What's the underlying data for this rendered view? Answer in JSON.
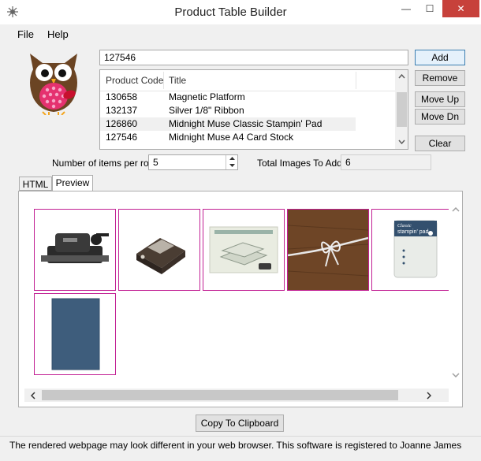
{
  "window": {
    "title": "Product Table Builder",
    "minimize": "—",
    "maximize": "☐",
    "close": "✕"
  },
  "menu": {
    "file": "File",
    "help": "Help"
  },
  "product_input": {
    "value": "127546"
  },
  "buttons": {
    "add": "Add",
    "remove": "Remove",
    "move_up": "Move Up",
    "move_down": "Move Dn",
    "clear": "Clear",
    "copy": "Copy To Clipboard"
  },
  "list": {
    "columns": [
      "Product Code",
      "Title"
    ],
    "rows": [
      {
        "code": "130658",
        "title": "Magnetic Platform"
      },
      {
        "code": "132137",
        "title": "Silver 1/8\" Ribbon"
      },
      {
        "code": "126860",
        "title": "Midnight Muse Classic Stampin' Pad"
      },
      {
        "code": "127546",
        "title": "Midnight Muse A4 Card Stock"
      }
    ]
  },
  "items_per_row": {
    "label": "Number of items per row",
    "value": "5"
  },
  "total_images": {
    "label": "Total Images To Add",
    "value": "6"
  },
  "tabs": [
    {
      "label": "HTML"
    },
    {
      "label": "Preview"
    }
  ],
  "preview": {
    "thumb_border_color": "#c21f93",
    "images": [
      {
        "icon": "die-cutting-machine-icon"
      },
      {
        "icon": "paper-punch-icon"
      },
      {
        "icon": "magnetic-platform-icon"
      },
      {
        "icon": "silver-ribbon-icon"
      },
      {
        "icon": "ink-pad-icon",
        "label_top": "Classic",
        "label_brand": "stampin' pad"
      },
      {
        "icon": "card-stock-icon"
      }
    ]
  },
  "status": {
    "text": "The rendered webpage may look different in your web browser.  This software is registered to Joanne James"
  }
}
